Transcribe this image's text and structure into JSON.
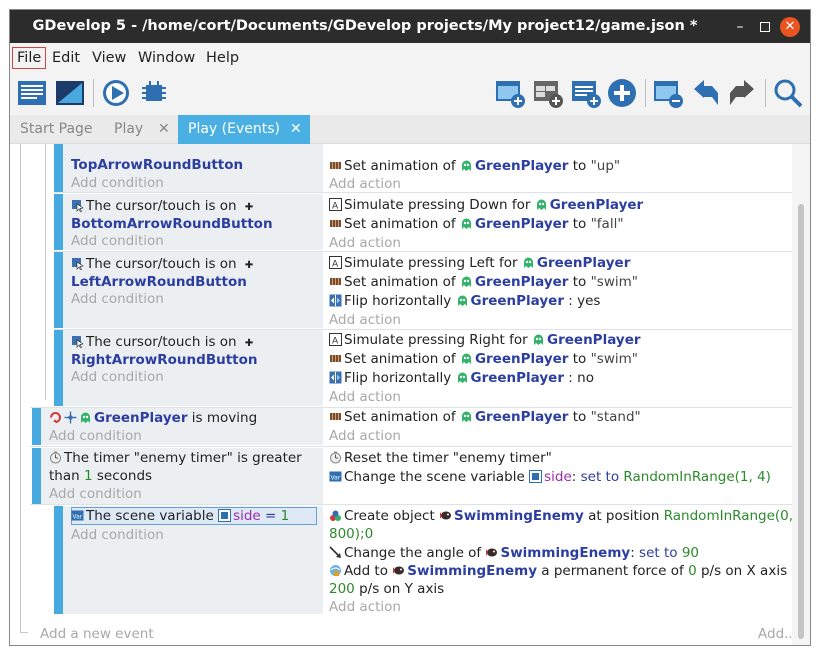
{
  "window": {
    "title": "GDevelop 5 - /home/cort/Documents/GDevelop projects/My project12/game.json *",
    "minimize": "–",
    "close": "✕"
  },
  "menu": {
    "file": "File",
    "edit": "Edit",
    "view": "View",
    "window": "Window",
    "help": "Help"
  },
  "tabs": {
    "start": "Start Page",
    "play": "Play",
    "play_events": "Play (Events)",
    "close": "✕"
  },
  "events": {
    "e1": {
      "cond_button": "TopArrowRoundButton",
      "add_condition": "Add condition",
      "act1_pre": "Set animation of",
      "act1_obj": "GreenPlayer",
      "act1_mid": "to",
      "act1_val": "\"up\"",
      "add_action": "Add action"
    },
    "e2": {
      "cond_text": "The cursor/touch is on",
      "cond_button": "BottomArrowRoundButton",
      "add_condition": "Add condition",
      "act1_pre": "Simulate pressing Down for",
      "act1_obj": "GreenPlayer",
      "act2_pre": "Set animation of",
      "act2_obj": "GreenPlayer",
      "act2_mid": "to",
      "act2_val": "\"fall\"",
      "add_action": "Add action"
    },
    "e3": {
      "cond_text": "The cursor/touch is on",
      "cond_button": "LeftArrowRoundButton",
      "add_condition": "Add condition",
      "act1_pre": "Simulate pressing Left for",
      "act1_obj": "GreenPlayer",
      "act2_pre": "Set animation of",
      "act2_obj": "GreenPlayer",
      "act2_mid": "to",
      "act2_val": "\"swim\"",
      "act3_pre": "Flip horizontally",
      "act3_obj": "GreenPlayer",
      "act3_val": ": yes",
      "add_action": "Add action"
    },
    "e4": {
      "cond_text": "The cursor/touch is on",
      "cond_button": "RightArrowRoundButton",
      "add_condition": "Add condition",
      "act1_pre": "Simulate pressing Right for",
      "act1_obj": "GreenPlayer",
      "act2_pre": "Set animation of",
      "act2_obj": "GreenPlayer",
      "act2_mid": "to",
      "act2_val": "\"swim\"",
      "act3_pre": "Flip horizontally",
      "act3_obj": "GreenPlayer",
      "act3_val": ": no",
      "add_action": "Add action"
    },
    "e5": {
      "cond_obj": "GreenPlayer",
      "cond_text": "is moving",
      "add_condition": "Add condition",
      "act1_pre": "Set animation of",
      "act1_obj": "GreenPlayer",
      "act1_mid": "to",
      "act1_val": "\"stand\"",
      "add_action": "Add action"
    },
    "e6": {
      "cond_line1": "The timer \"enemy timer\" is greater",
      "cond_line2_pre": "than",
      "cond_num": "1",
      "cond_line2_post": "seconds",
      "add_condition": "Add condition",
      "act1": "Reset the timer \"enemy timer\"",
      "act2_pre": "Change the scene variable",
      "act2_var": "side",
      "act2_op": "set to",
      "act2_val": "RandomInRange(1, 4)"
    },
    "e7": {
      "cond_pre": "The scene variable",
      "cond_var": "side",
      "cond_op": "=",
      "cond_val": "1",
      "add_condition": "Add condition",
      "act1_pre": "Create object",
      "act1_obj": "SwimmingEnemy",
      "act1_mid": "at position",
      "act1_val_a": "RandomInRange(0,",
      "act1_val_b": "800);0",
      "act2_pre": "Change the angle of",
      "act2_obj": "SwimmingEnemy",
      "act2_op": "set to",
      "act2_val": "90",
      "act3_pre": "Add to",
      "act3_obj": "SwimmingEnemy",
      "act3_mid": "a permanent force of",
      "act3_num1": "0",
      "act3_mid2": "p/s on X axis and",
      "act3_num2": "200",
      "act3_post": "p/s on Y axis",
      "add_action": "Add action"
    },
    "add_new_event": "Add a new event",
    "add_more": "Add..."
  },
  "colors": {
    "accent": "#4ab0e4",
    "event_bar": "#46a9df",
    "object_name": "#2c3ea0",
    "number": "#2c8a2c",
    "variable": "#9b2cb0",
    "titlebar": "#2c2c2c",
    "close_button": "#e95420"
  }
}
